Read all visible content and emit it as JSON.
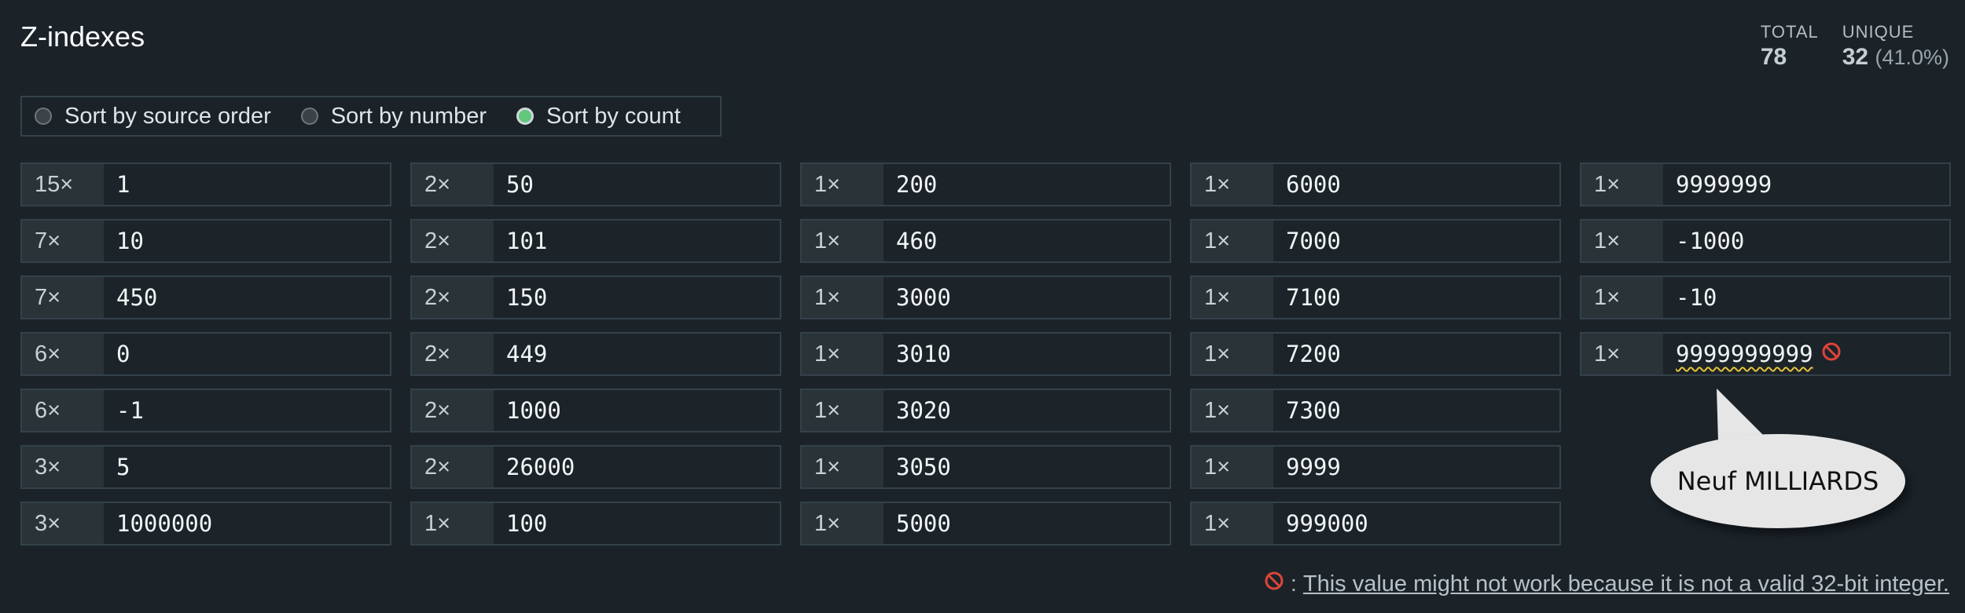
{
  "header": {
    "title": "Z-indexes",
    "total_label": "TOTAL",
    "total_value": "78",
    "unique_label": "UNIQUE",
    "unique_value": "32",
    "unique_pct": "(41.0%)"
  },
  "sort": {
    "options": [
      "Sort by source order",
      "Sort by number",
      "Sort by count"
    ],
    "selected": "Sort by count"
  },
  "columns": [
    [
      {
        "count": "15×",
        "value": "1"
      },
      {
        "count": "7×",
        "value": "10"
      },
      {
        "count": "7×",
        "value": "450"
      },
      {
        "count": "6×",
        "value": "0"
      },
      {
        "count": "6×",
        "value": "-1"
      },
      {
        "count": "3×",
        "value": "5"
      },
      {
        "count": "3×",
        "value": "1000000"
      }
    ],
    [
      {
        "count": "2×",
        "value": "50"
      },
      {
        "count": "2×",
        "value": "101"
      },
      {
        "count": "2×",
        "value": "150"
      },
      {
        "count": "2×",
        "value": "449"
      },
      {
        "count": "2×",
        "value": "1000"
      },
      {
        "count": "2×",
        "value": "26000"
      },
      {
        "count": "1×",
        "value": "100"
      }
    ],
    [
      {
        "count": "1×",
        "value": "200"
      },
      {
        "count": "1×",
        "value": "460"
      },
      {
        "count": "1×",
        "value": "3000"
      },
      {
        "count": "1×",
        "value": "3010"
      },
      {
        "count": "1×",
        "value": "3020"
      },
      {
        "count": "1×",
        "value": "3050"
      },
      {
        "count": "1×",
        "value": "5000"
      }
    ],
    [
      {
        "count": "1×",
        "value": "6000"
      },
      {
        "count": "1×",
        "value": "7000"
      },
      {
        "count": "1×",
        "value": "7100"
      },
      {
        "count": "1×",
        "value": "7200"
      },
      {
        "count": "1×",
        "value": "7300"
      },
      {
        "count": "1×",
        "value": "9999"
      },
      {
        "count": "1×",
        "value": "999000"
      }
    ],
    [
      {
        "count": "1×",
        "value": "9999999"
      },
      {
        "count": "1×",
        "value": "-1000"
      },
      {
        "count": "1×",
        "value": "-10"
      },
      {
        "count": "1×",
        "value": "9999999999",
        "invalid": true
      }
    ]
  ],
  "bubble": {
    "text": "Neuf MILLIARDS"
  },
  "footnote": {
    "separator": ":",
    "text": "This value might not work because it is not a valid 32-bit integer."
  },
  "colors": {
    "background": "#1b2329",
    "radio_selected": "#61c77b",
    "invalid_underline": "#e7c23a",
    "ban_icon": "#e0443a"
  },
  "icons": {
    "invalid_marker": "ban-icon"
  }
}
